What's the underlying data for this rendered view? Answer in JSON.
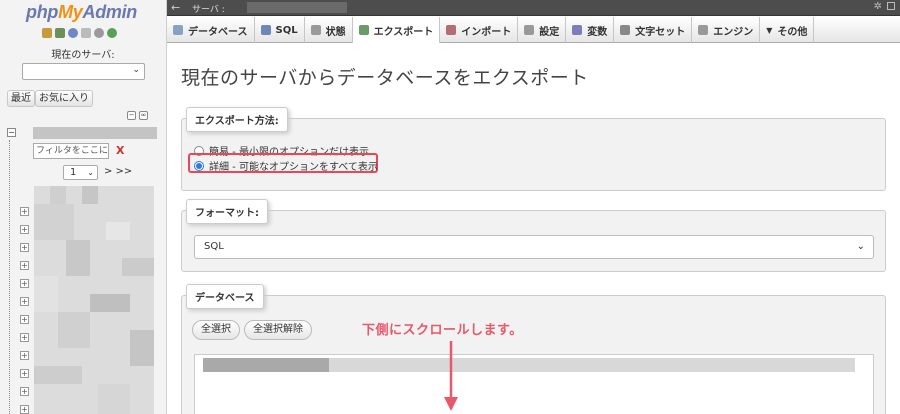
{
  "nav": {
    "logo_php": "php",
    "logo_my": "My",
    "logo_admin": "Admin",
    "current_server_label": "現在のサーバ:",
    "recent_label": "最近",
    "favorites_label": "お気に入り",
    "filter_placeholder": "フィルタをここに,",
    "filter_clear": "X",
    "page_value": "1",
    "page_next": "> >>",
    "icons": [
      "home-icon",
      "logout-icon",
      "help-icon",
      "docs-icon",
      "settings-icon",
      "reload-icon"
    ]
  },
  "topbar": {
    "server_label": "サーバ :"
  },
  "tabs": [
    {
      "label": "データベース",
      "icon": "database-icon",
      "color": "#8aa0c0"
    },
    {
      "label": "SQL",
      "icon": "sql-icon",
      "color": "#6f86b8"
    },
    {
      "label": "状態",
      "icon": "status-icon",
      "color": "#9a9a9a"
    },
    {
      "label": "エクスポート",
      "icon": "export-icon",
      "color": "#6b9b6b",
      "active": true
    },
    {
      "label": "インポート",
      "icon": "import-icon",
      "color": "#b56d6d"
    },
    {
      "label": "設定",
      "icon": "wrench-icon",
      "color": "#999999"
    },
    {
      "label": "変数",
      "icon": "variables-icon",
      "color": "#7d7dbb"
    },
    {
      "label": "文字セット",
      "icon": "charset-icon",
      "color": "#888888"
    },
    {
      "label": "エンジン",
      "icon": "engine-icon",
      "color": "#999999"
    },
    {
      "label": "その他",
      "icon": "more-icon",
      "color": "#555555"
    }
  ],
  "main": {
    "title": "現在のサーバからデータベースをエクスポート",
    "method_legend": "エクスポート方法:",
    "method_quick": "簡易 - 最小限のオプションだけ表示",
    "method_custom": "詳細 - 可能なオプションをすべて表示",
    "format_legend": "フォーマット:",
    "format_value": "SQL",
    "db_legend": "データベース",
    "select_all": "全選択",
    "unselect_all": "全選択解除",
    "scroll_note": "下側にスクロールします。"
  },
  "colors": {
    "accent_red": "#e8465a",
    "radio_blue": "#2a7ae2"
  }
}
